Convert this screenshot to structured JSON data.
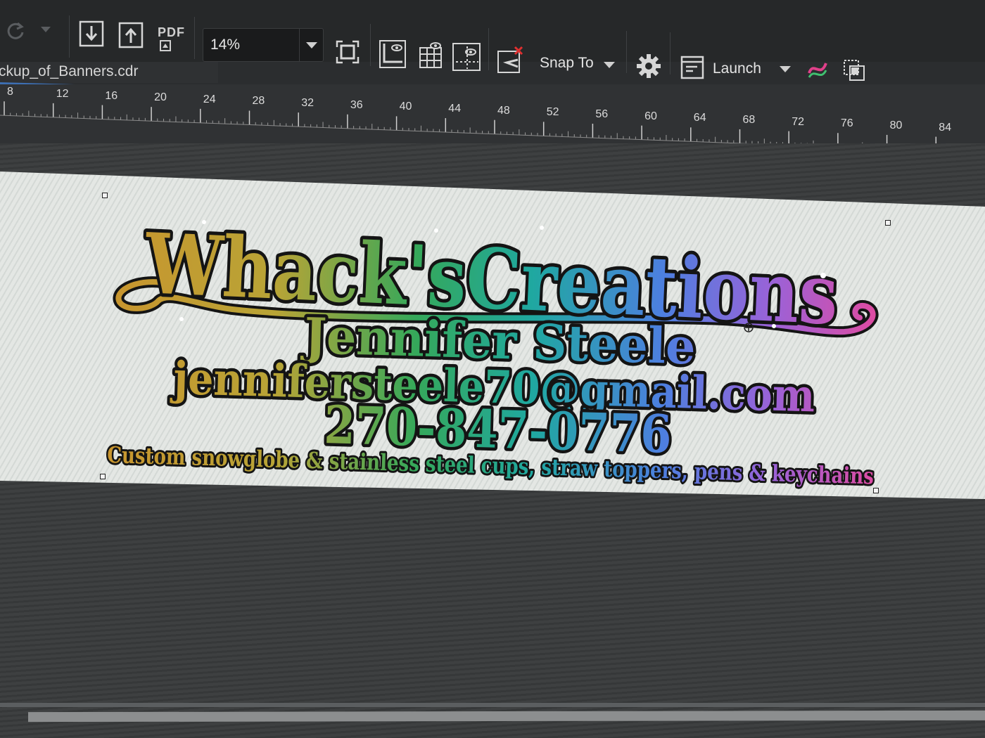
{
  "toolbar": {
    "pdf_label": "PDF",
    "zoom_value": "14%",
    "snap_label": "Snap To",
    "launch_label": "Launch"
  },
  "document": {
    "tab_name": "ckup_of_Banners.cdr"
  },
  "ruler": {
    "labels": [
      "8",
      "12",
      "16",
      "20",
      "24",
      "28",
      "32",
      "36",
      "40",
      "44",
      "48",
      "52",
      "56",
      "60",
      "64",
      "68",
      "72",
      "76",
      "80",
      "84"
    ]
  },
  "banner": {
    "title": "Whack'sCreations",
    "name": "Jennifer Steele",
    "email": "jennifersteele70@gmail.com",
    "phone": "270-847-0776",
    "tagline": "Custom snowglobe & stainless steel cups, straw toppers, pens & keychains"
  },
  "colors": {
    "gold": "#c9952e",
    "green": "#35a85a",
    "teal": "#1fa8a0",
    "blue": "#4d7fe0",
    "purple": "#9a62d8",
    "pink": "#e04aa0",
    "selection_blue": "#3d6fb3"
  }
}
